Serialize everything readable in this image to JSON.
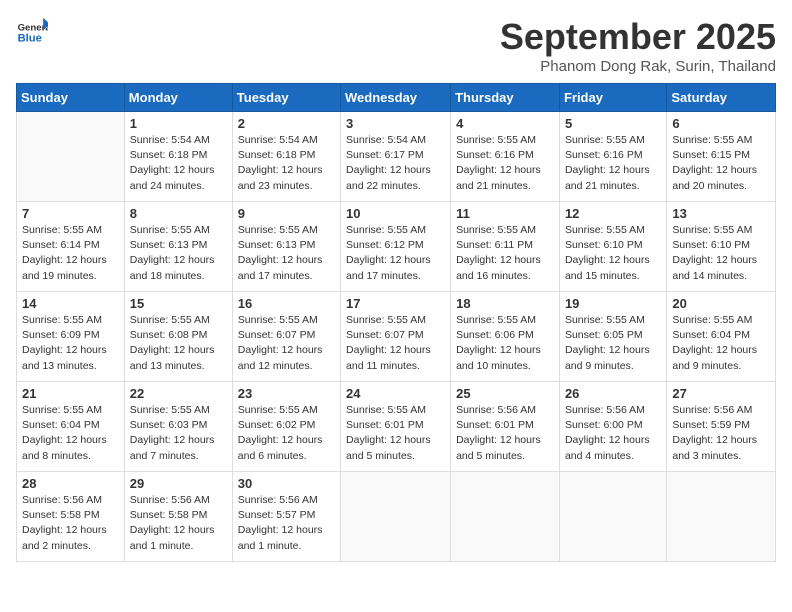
{
  "header": {
    "logo_line1": "General",
    "logo_line2": "Blue",
    "month_title": "September 2025",
    "location": "Phanom Dong Rak, Surin, Thailand"
  },
  "days_of_week": [
    "Sunday",
    "Monday",
    "Tuesday",
    "Wednesday",
    "Thursday",
    "Friday",
    "Saturday"
  ],
  "weeks": [
    [
      {
        "day": "",
        "detail": ""
      },
      {
        "day": "1",
        "detail": "Sunrise: 5:54 AM\nSunset: 6:18 PM\nDaylight: 12 hours\nand 24 minutes."
      },
      {
        "day": "2",
        "detail": "Sunrise: 5:54 AM\nSunset: 6:18 PM\nDaylight: 12 hours\nand 23 minutes."
      },
      {
        "day": "3",
        "detail": "Sunrise: 5:54 AM\nSunset: 6:17 PM\nDaylight: 12 hours\nand 22 minutes."
      },
      {
        "day": "4",
        "detail": "Sunrise: 5:55 AM\nSunset: 6:16 PM\nDaylight: 12 hours\nand 21 minutes."
      },
      {
        "day": "5",
        "detail": "Sunrise: 5:55 AM\nSunset: 6:16 PM\nDaylight: 12 hours\nand 21 minutes."
      },
      {
        "day": "6",
        "detail": "Sunrise: 5:55 AM\nSunset: 6:15 PM\nDaylight: 12 hours\nand 20 minutes."
      }
    ],
    [
      {
        "day": "7",
        "detail": "Sunrise: 5:55 AM\nSunset: 6:14 PM\nDaylight: 12 hours\nand 19 minutes."
      },
      {
        "day": "8",
        "detail": "Sunrise: 5:55 AM\nSunset: 6:13 PM\nDaylight: 12 hours\nand 18 minutes."
      },
      {
        "day": "9",
        "detail": "Sunrise: 5:55 AM\nSunset: 6:13 PM\nDaylight: 12 hours\nand 17 minutes."
      },
      {
        "day": "10",
        "detail": "Sunrise: 5:55 AM\nSunset: 6:12 PM\nDaylight: 12 hours\nand 17 minutes."
      },
      {
        "day": "11",
        "detail": "Sunrise: 5:55 AM\nSunset: 6:11 PM\nDaylight: 12 hours\nand 16 minutes."
      },
      {
        "day": "12",
        "detail": "Sunrise: 5:55 AM\nSunset: 6:10 PM\nDaylight: 12 hours\nand 15 minutes."
      },
      {
        "day": "13",
        "detail": "Sunrise: 5:55 AM\nSunset: 6:10 PM\nDaylight: 12 hours\nand 14 minutes."
      }
    ],
    [
      {
        "day": "14",
        "detail": "Sunrise: 5:55 AM\nSunset: 6:09 PM\nDaylight: 12 hours\nand 13 minutes."
      },
      {
        "day": "15",
        "detail": "Sunrise: 5:55 AM\nSunset: 6:08 PM\nDaylight: 12 hours\nand 13 minutes."
      },
      {
        "day": "16",
        "detail": "Sunrise: 5:55 AM\nSunset: 6:07 PM\nDaylight: 12 hours\nand 12 minutes."
      },
      {
        "day": "17",
        "detail": "Sunrise: 5:55 AM\nSunset: 6:07 PM\nDaylight: 12 hours\nand 11 minutes."
      },
      {
        "day": "18",
        "detail": "Sunrise: 5:55 AM\nSunset: 6:06 PM\nDaylight: 12 hours\nand 10 minutes."
      },
      {
        "day": "19",
        "detail": "Sunrise: 5:55 AM\nSunset: 6:05 PM\nDaylight: 12 hours\nand 9 minutes."
      },
      {
        "day": "20",
        "detail": "Sunrise: 5:55 AM\nSunset: 6:04 PM\nDaylight: 12 hours\nand 9 minutes."
      }
    ],
    [
      {
        "day": "21",
        "detail": "Sunrise: 5:55 AM\nSunset: 6:04 PM\nDaylight: 12 hours\nand 8 minutes."
      },
      {
        "day": "22",
        "detail": "Sunrise: 5:55 AM\nSunset: 6:03 PM\nDaylight: 12 hours\nand 7 minutes."
      },
      {
        "day": "23",
        "detail": "Sunrise: 5:55 AM\nSunset: 6:02 PM\nDaylight: 12 hours\nand 6 minutes."
      },
      {
        "day": "24",
        "detail": "Sunrise: 5:55 AM\nSunset: 6:01 PM\nDaylight: 12 hours\nand 5 minutes."
      },
      {
        "day": "25",
        "detail": "Sunrise: 5:56 AM\nSunset: 6:01 PM\nDaylight: 12 hours\nand 5 minutes."
      },
      {
        "day": "26",
        "detail": "Sunrise: 5:56 AM\nSunset: 6:00 PM\nDaylight: 12 hours\nand 4 minutes."
      },
      {
        "day": "27",
        "detail": "Sunrise: 5:56 AM\nSunset: 5:59 PM\nDaylight: 12 hours\nand 3 minutes."
      }
    ],
    [
      {
        "day": "28",
        "detail": "Sunrise: 5:56 AM\nSunset: 5:58 PM\nDaylight: 12 hours\nand 2 minutes."
      },
      {
        "day": "29",
        "detail": "Sunrise: 5:56 AM\nSunset: 5:58 PM\nDaylight: 12 hours\nand 1 minute."
      },
      {
        "day": "30",
        "detail": "Sunrise: 5:56 AM\nSunset: 5:57 PM\nDaylight: 12 hours\nand 1 minute."
      },
      {
        "day": "",
        "detail": ""
      },
      {
        "day": "",
        "detail": ""
      },
      {
        "day": "",
        "detail": ""
      },
      {
        "day": "",
        "detail": ""
      }
    ]
  ]
}
